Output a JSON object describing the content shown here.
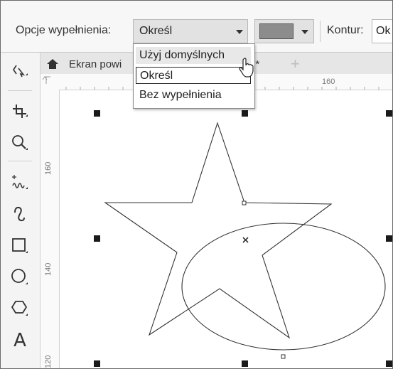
{
  "property_bar": {
    "fill_label": "Opcje wypełnienia:",
    "fill_value": "Określ",
    "fill_swatch_color": "#8c8c8c",
    "outline_label": "Kontur:",
    "outline_value": "Ok"
  },
  "fill_dropdown": {
    "options": [
      "Użyj domyślnych",
      "Określ",
      "Bez wypełnienia"
    ],
    "hovered": "Użyj domyślnych",
    "selected": "Określ"
  },
  "toolbox": {
    "tools": [
      "pick-tool",
      "crop-tool",
      "zoom-tool",
      "freehand-tool",
      "artistic-media-tool",
      "rectangle-tool",
      "ellipse-tool",
      "polygon-tool",
      "text-tool"
    ],
    "text_tool_label": "A"
  },
  "document_tabs": {
    "home_icon": "home-icon",
    "active_tab_label": "Ekran powi",
    "active_tab_suffix": "1*",
    "add_tab_label": "+"
  },
  "rulers": {
    "top_labels": [
      "160"
    ],
    "left_labels": [
      "160",
      "140",
      "120"
    ]
  }
}
